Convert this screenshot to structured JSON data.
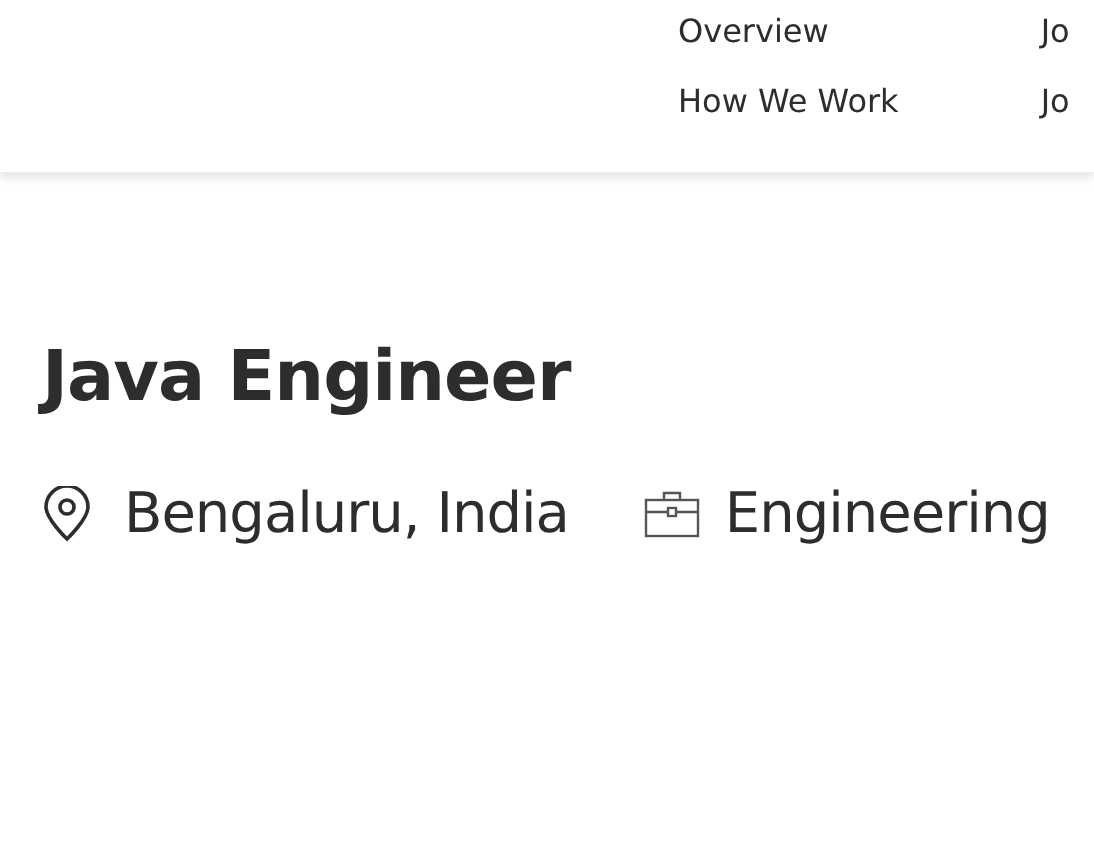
{
  "nav": {
    "columns": [
      [
        "Overview",
        "How We Work"
      ],
      [
        "Jo",
        "Jo"
      ]
    ]
  },
  "job": {
    "title": "Java Engineer",
    "location": "Bengaluru, India",
    "department": "Engineering"
  }
}
